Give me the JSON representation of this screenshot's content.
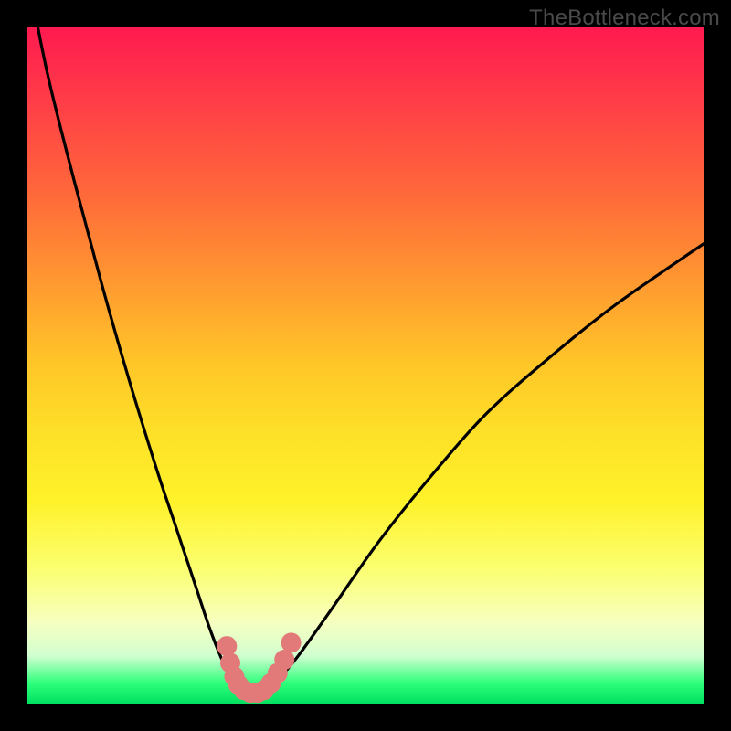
{
  "watermark": "TheBottleneck.com",
  "colors": {
    "frame": "#000000",
    "curve": "#000000",
    "marker": "#e37a7a",
    "gradient_top": "#ff1a50",
    "gradient_bottom": "#00e060"
  },
  "chart_data": {
    "type": "line",
    "title": "",
    "xlabel": "",
    "ylabel": "",
    "xlim": [
      0,
      100
    ],
    "ylim": [
      0,
      100
    ],
    "series": [
      {
        "name": "bottleneck-curve",
        "x": [
          0,
          3,
          7,
          11,
          15,
          19,
          22,
          25,
          27,
          29,
          30.5,
          32,
          33,
          34,
          35,
          37,
          40,
          45,
          52,
          60,
          68,
          77,
          87,
          100
        ],
        "y": [
          108,
          93,
          77,
          62,
          48,
          35,
          26,
          17,
          11,
          6,
          3.5,
          2,
          1.5,
          1.5,
          2,
          3.5,
          7,
          14,
          24,
          34,
          43,
          51,
          59,
          68
        ]
      }
    ],
    "markers": {
      "name": "highlight-band",
      "points": [
        {
          "x": 29.5,
          "y": 8.5
        },
        {
          "x": 30.0,
          "y": 6.0
        },
        {
          "x": 30.6,
          "y": 4.0
        },
        {
          "x": 31.2,
          "y": 2.8
        },
        {
          "x": 32.0,
          "y": 2.0
        },
        {
          "x": 33.0,
          "y": 1.6
        },
        {
          "x": 34.0,
          "y": 1.6
        },
        {
          "x": 35.0,
          "y": 2.0
        },
        {
          "x": 36.0,
          "y": 3.0
        },
        {
          "x": 37.0,
          "y": 4.5
        },
        {
          "x": 38.0,
          "y": 6.5
        },
        {
          "x": 39.0,
          "y": 9.0
        }
      ]
    }
  }
}
